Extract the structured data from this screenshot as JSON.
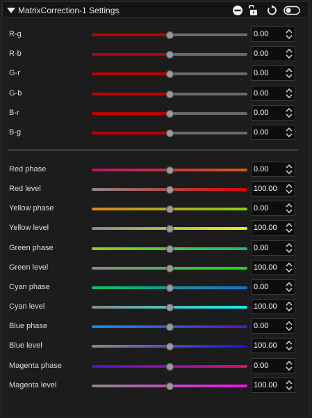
{
  "panel": {
    "title": "MatrixCorrection-1 Settings",
    "icons": [
      "minus-circle-icon",
      "unlock-icon",
      "reset-icon",
      "toggle-icon"
    ]
  },
  "matrix_params": [
    {
      "label": "R-g",
      "value": "0.00",
      "level": 0.5
    },
    {
      "label": "R-b",
      "value": "0.00",
      "level": 0.5
    },
    {
      "label": "G-r",
      "value": "0.00",
      "level": 0.5
    },
    {
      "label": "G-b",
      "value": "0.00",
      "level": 0.5
    },
    {
      "label": "B-r",
      "value": "0.00",
      "level": 0.5
    },
    {
      "label": "B-g",
      "value": "0.00",
      "level": 0.5
    }
  ],
  "color_params": [
    {
      "label": "Red phase",
      "value": "0.00",
      "level": 0.5,
      "colors": [
        "#c0106a",
        "#d85a10"
      ]
    },
    {
      "label": "Red level",
      "value": "100.00",
      "level": 0.5,
      "colors": [
        "#8a8a8a",
        "#e00000"
      ]
    },
    {
      "label": "Yellow phase",
      "value": "0.00",
      "level": 0.5,
      "colors": [
        "#d8881a",
        "#88d010"
      ]
    },
    {
      "label": "Yellow level",
      "value": "100.00",
      "level": 0.5,
      "colors": [
        "#8a8a8a",
        "#f0f000"
      ]
    },
    {
      "label": "Green phase",
      "value": "0.00",
      "level": 0.5,
      "colors": [
        "#90d010",
        "#10c070"
      ]
    },
    {
      "label": "Green level",
      "value": "100.00",
      "level": 0.5,
      "colors": [
        "#8a8a8a",
        "#10e010"
      ]
    },
    {
      "label": "Cyan phase",
      "value": "0.00",
      "level": 0.5,
      "colors": [
        "#10c060",
        "#1070d0"
      ]
    },
    {
      "label": "Cyan level",
      "value": "100.00",
      "level": 0.5,
      "colors": [
        "#8a8a8a",
        "#10f0f0"
      ]
    },
    {
      "label": "Blue phase",
      "value": "0.00",
      "level": 0.5,
      "colors": [
        "#1090e0",
        "#5a10c0"
      ]
    },
    {
      "label": "Blue level",
      "value": "100.00",
      "level": 0.5,
      "colors": [
        "#8a8a8a",
        "#1010f0"
      ]
    },
    {
      "label": "Magenta phase",
      "value": "0.00",
      "level": 0.5,
      "colors": [
        "#5010d0",
        "#d01070"
      ]
    },
    {
      "label": "Magenta level",
      "value": "100.00",
      "level": 0.5,
      "colors": [
        "#8a8a8a",
        "#f010f0"
      ]
    }
  ],
  "matrix_track_colors": [
    "#c00000",
    "#6a6a6a"
  ],
  "thumb_color": "#9a9a9a"
}
